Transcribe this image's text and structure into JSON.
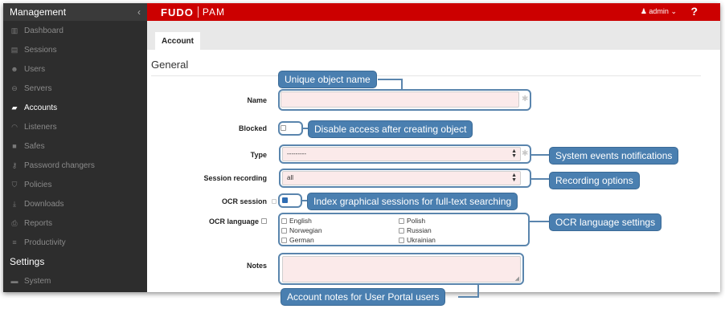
{
  "sidebar": {
    "header": "Management",
    "items": [
      {
        "label": "Dashboard",
        "icon": "bar-chart-icon",
        "glyph": "▥"
      },
      {
        "label": "Sessions",
        "icon": "film-icon",
        "glyph": "▤"
      },
      {
        "label": "Users",
        "icon": "users-icon",
        "glyph": "☻"
      },
      {
        "label": "Servers",
        "icon": "server-icon",
        "glyph": "⊖"
      },
      {
        "label": "Accounts",
        "icon": "account-icon",
        "glyph": "▰"
      },
      {
        "label": "Listeners",
        "icon": "rss-icon",
        "glyph": "◠"
      },
      {
        "label": "Safes",
        "icon": "safe-icon",
        "glyph": "■"
      },
      {
        "label": "Password changers",
        "icon": "key-icon",
        "glyph": "⚷"
      },
      {
        "label": "Policies",
        "icon": "shield-icon",
        "glyph": "⛉"
      },
      {
        "label": "Downloads",
        "icon": "download-icon",
        "glyph": "⤓"
      },
      {
        "label": "Reports",
        "icon": "print-icon",
        "glyph": "⎙"
      },
      {
        "label": "Productivity",
        "icon": "list-icon",
        "glyph": "≡"
      }
    ],
    "section": "Settings",
    "settings_items": [
      {
        "label": "System",
        "icon": "folder-icon",
        "glyph": "▬"
      }
    ]
  },
  "topbar": {
    "logo": "FUDO",
    "logo2": "PAM",
    "user": "admin",
    "help": "?"
  },
  "tabs": [
    "Account"
  ],
  "form": {
    "section_title": "General",
    "name_label": "Name",
    "blocked_label": "Blocked",
    "type_label": "Type",
    "type_value": "---------",
    "session_recording_label": "Session recording",
    "session_recording_value": "all",
    "ocr_session_label": "OCR session",
    "ocr_session_checked": true,
    "ocr_language_label": "OCR language",
    "languages": [
      "English",
      "Polish",
      "Norwegian",
      "Russian",
      "German",
      "Ukrainian"
    ],
    "notes_label": "Notes"
  },
  "callouts": {
    "name": "Unique object name",
    "blocked": "Disable access after creating object",
    "type": "System events notifications",
    "recording": "Recording options",
    "ocr_session": "Index graphical sessions for full-text searching",
    "ocr_language": "OCR language settings",
    "notes": "Account notes for User Portal users"
  },
  "colors": {
    "sidebar_bg": "#2d2d2d",
    "topbar_red": "#cc0000",
    "callout_blue": "#4a7fb0",
    "required_field": "#fbeaea"
  }
}
